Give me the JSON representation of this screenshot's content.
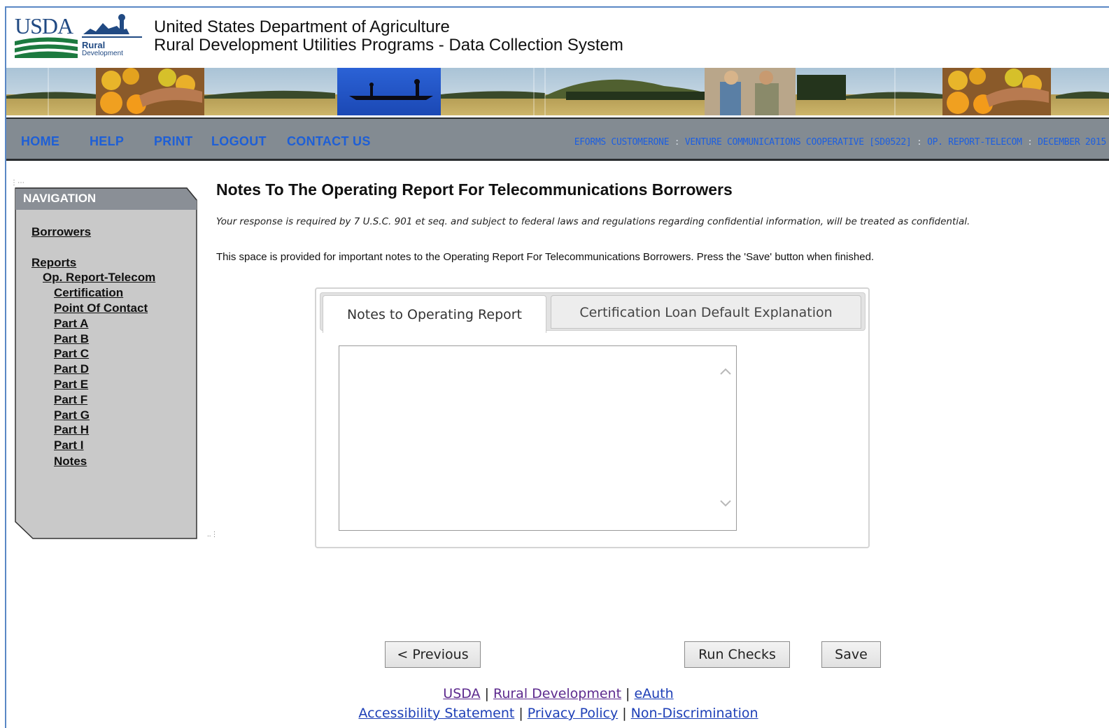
{
  "header": {
    "logo_text": "USDA",
    "logo_rural": "Rural",
    "logo_development": "Development",
    "title_line1": "United States Department of Agriculture",
    "title_line2": "Rural Development Utilities Programs - Data Collection System"
  },
  "nav": {
    "links": [
      "HOME",
      "HELP",
      "PRINT",
      "LOGOUT",
      "CONTACT US"
    ],
    "breadcrumb": {
      "user": "EFORMS CUSTOMERONE",
      "borrower": "VENTURE COMMUNICATIONS COOPERATIVE [SD0522]",
      "report": "OP. REPORT-TELECOM",
      "period": "DECEMBER 2015",
      "separator": ":"
    }
  },
  "sidebar": {
    "title": "NAVIGATION",
    "borrowers": "Borrowers",
    "reports": "Reports",
    "op_report": "Op. Report-Telecom",
    "items": [
      "Certification",
      "Point Of Contact",
      "Part A",
      "Part B",
      "Part C",
      "Part D",
      "Part E",
      "Part F",
      "Part G",
      "Part H",
      "Part I",
      "Notes"
    ]
  },
  "main": {
    "title": "Notes To The Operating Report For Telecommunications Borrowers",
    "confidential_note": "Your response is required by 7 U.S.C. 901 et seq. and subject to federal laws and regulations regarding confidential information, will be treated as confidential.",
    "description": "This space is provided for important notes to the Operating Report For Telecommunications Borrowers. Press the 'Save' button when finished.",
    "tabs": [
      {
        "label": "Notes to Operating Report",
        "active": true
      },
      {
        "label": "Certification Loan Default Explanation",
        "active": false
      }
    ],
    "notes_value": ""
  },
  "buttons": {
    "previous": "< Previous",
    "run_checks": "Run Checks",
    "save": "Save"
  },
  "footer": {
    "row1": [
      "USDA",
      "Rural Development",
      "eAuth"
    ],
    "row2": [
      "Accessibility Statement",
      "Privacy Policy",
      "Non-Discrimination"
    ],
    "separator": "|"
  },
  "colors": {
    "nav_bar": "#838b92",
    "nav_link": "#1e5fd6",
    "sidebar_panel": "#c9c9c9",
    "sidebar_header": "#8a8f96",
    "footer_link": "#1d3fb7"
  },
  "icons": [
    "usda-rural-development-logo",
    "chevron-up-icon",
    "chevron-down-icon"
  ]
}
